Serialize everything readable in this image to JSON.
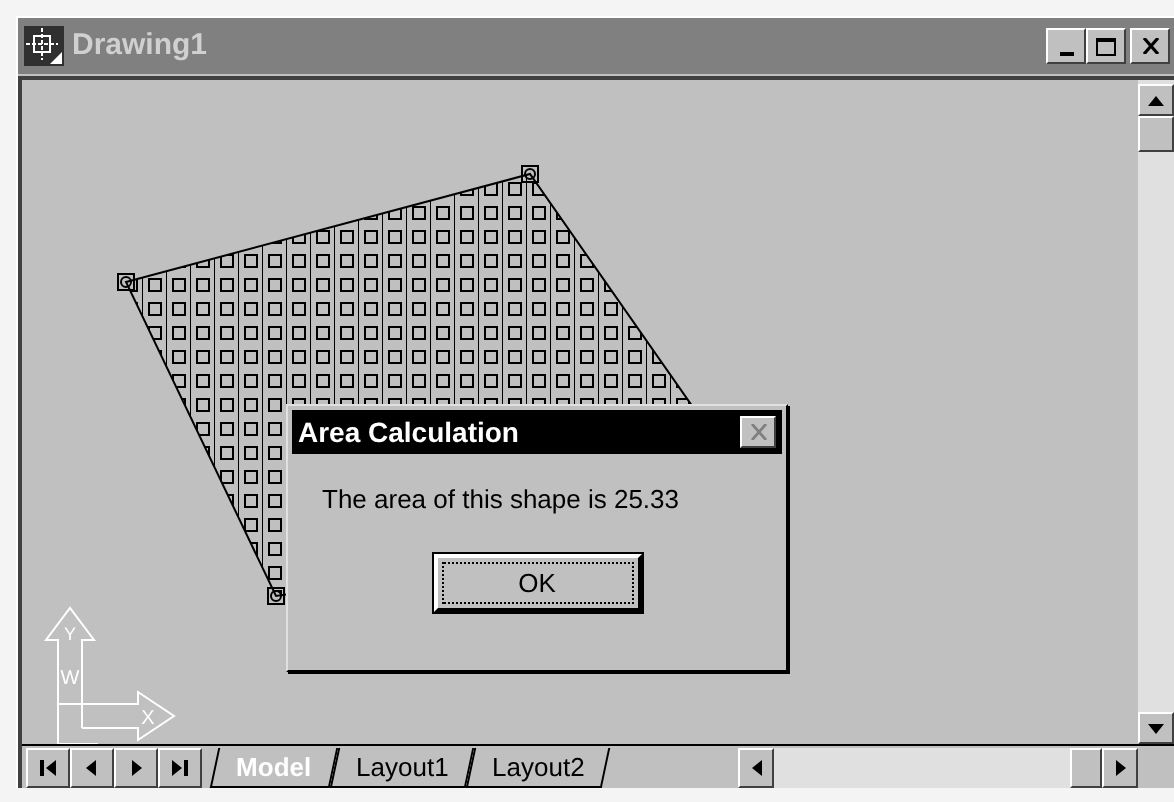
{
  "window": {
    "title": "Drawing1"
  },
  "drawing": {
    "ucs_labels": [
      "Y",
      "W",
      "X"
    ]
  },
  "dialog": {
    "title": "Area Calculation",
    "message": "The area of this shape is 25.33",
    "button": "OK"
  },
  "layout_tabs": [
    {
      "label": "Model",
      "selected": true
    },
    {
      "label": "Layout1",
      "selected": false
    },
    {
      "label": "Layout2",
      "selected": false
    }
  ]
}
